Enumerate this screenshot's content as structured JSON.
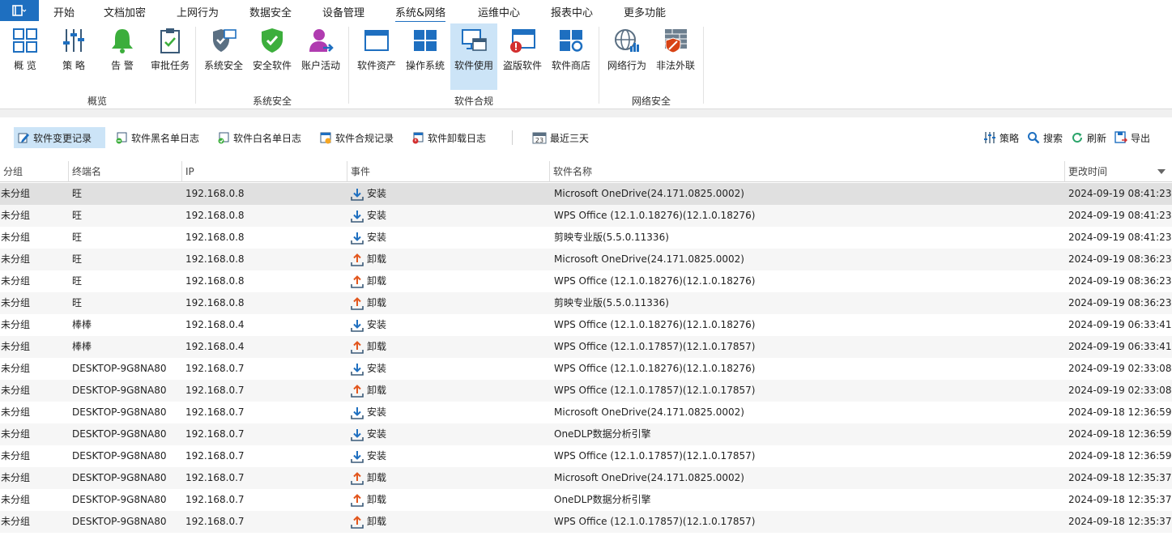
{
  "menu": {
    "items": [
      "开始",
      "文档加密",
      "上网行为",
      "数据安全",
      "设备管理",
      "系统&网络",
      "运维中心",
      "报表中心",
      "更多功能"
    ],
    "active_index": 5
  },
  "ribbon": {
    "groups": [
      {
        "label": "概览",
        "buttons": [
          {
            "label": "概 览",
            "icon": "grid-icon"
          },
          {
            "label": "策 略",
            "icon": "sliders-icon"
          },
          {
            "label": "告 警",
            "icon": "bell-icon"
          },
          {
            "label": "审批任务",
            "icon": "clipboard-check-icon"
          }
        ]
      },
      {
        "label": "系统安全",
        "buttons": [
          {
            "label": "系统安全",
            "icon": "shield-monitor-icon"
          },
          {
            "label": "安全软件",
            "icon": "shield-check-icon"
          },
          {
            "label": "账户活动",
            "icon": "user-arrow-icon"
          }
        ]
      },
      {
        "label": "软件合规",
        "buttons": [
          {
            "label": "软件资产",
            "icon": "window-icon"
          },
          {
            "label": "操作系统",
            "icon": "windows-logo-icon"
          },
          {
            "label": "软件使用",
            "icon": "monitor-window-icon"
          },
          {
            "label": "盗版软件",
            "icon": "window-warning-icon"
          },
          {
            "label": "软件商店",
            "icon": "store-icon"
          }
        ]
      },
      {
        "label": "网络安全",
        "buttons": [
          {
            "label": "网络行为",
            "icon": "globe-chart-icon"
          },
          {
            "label": "非法外联",
            "icon": "firewall-icon"
          }
        ]
      }
    ],
    "selected": "软件使用"
  },
  "toolbar": {
    "tabs": [
      "软件变更记录",
      "软件黑名单日志",
      "软件白名单日志",
      "软件合规记录",
      "软件卸载日志"
    ],
    "date_filter": "最近三天",
    "actions": [
      "策略",
      "搜索",
      "刷新",
      "导出"
    ]
  },
  "table": {
    "columns": [
      "分组",
      "终端名",
      "IP",
      "事件",
      "软件名称",
      "更改时间"
    ],
    "rows": [
      {
        "group": "未分组",
        "terminal": "旺",
        "ip": "192.168.0.8",
        "event": "安装",
        "type": "install",
        "software": "Microsoft OneDrive(24.171.0825.0002)",
        "time": "2024-09-19 08:41:23"
      },
      {
        "group": "未分组",
        "terminal": "旺",
        "ip": "192.168.0.8",
        "event": "安装",
        "type": "install",
        "software": "WPS Office (12.1.0.18276)(12.1.0.18276)",
        "time": "2024-09-19 08:41:23"
      },
      {
        "group": "未分组",
        "terminal": "旺",
        "ip": "192.168.0.8",
        "event": "安装",
        "type": "install",
        "software": "剪映专业版(5.5.0.11336)",
        "time": "2024-09-19 08:41:23"
      },
      {
        "group": "未分组",
        "terminal": "旺",
        "ip": "192.168.0.8",
        "event": "卸载",
        "type": "uninstall",
        "software": "Microsoft OneDrive(24.171.0825.0002)",
        "time": "2024-09-19 08:36:23"
      },
      {
        "group": "未分组",
        "terminal": "旺",
        "ip": "192.168.0.8",
        "event": "卸载",
        "type": "uninstall",
        "software": "WPS Office (12.1.0.18276)(12.1.0.18276)",
        "time": "2024-09-19 08:36:23"
      },
      {
        "group": "未分组",
        "terminal": "旺",
        "ip": "192.168.0.8",
        "event": "卸载",
        "type": "uninstall",
        "software": "剪映专业版(5.5.0.11336)",
        "time": "2024-09-19 08:36:23"
      },
      {
        "group": "未分组",
        "terminal": "棒棒",
        "ip": "192.168.0.4",
        "event": "安装",
        "type": "install",
        "software": "WPS Office (12.1.0.18276)(12.1.0.18276)",
        "time": "2024-09-19 06:33:41"
      },
      {
        "group": "未分组",
        "terminal": "棒棒",
        "ip": "192.168.0.4",
        "event": "卸载",
        "type": "uninstall",
        "software": "WPS Office (12.1.0.17857)(12.1.0.17857)",
        "time": "2024-09-19 06:33:41"
      },
      {
        "group": "未分组",
        "terminal": "DESKTOP-9G8NA80",
        "ip": "192.168.0.7",
        "event": "安装",
        "type": "install",
        "software": "WPS Office (12.1.0.18276)(12.1.0.18276)",
        "time": "2024-09-19 02:33:08"
      },
      {
        "group": "未分组",
        "terminal": "DESKTOP-9G8NA80",
        "ip": "192.168.0.7",
        "event": "卸载",
        "type": "uninstall",
        "software": "WPS Office (12.1.0.17857)(12.1.0.17857)",
        "time": "2024-09-19 02:33:08"
      },
      {
        "group": "未分组",
        "terminal": "DESKTOP-9G8NA80",
        "ip": "192.168.0.7",
        "event": "安装",
        "type": "install",
        "software": "Microsoft OneDrive(24.171.0825.0002)",
        "time": "2024-09-18 12:36:59"
      },
      {
        "group": "未分组",
        "terminal": "DESKTOP-9G8NA80",
        "ip": "192.168.0.7",
        "event": "安装",
        "type": "install",
        "software": "OneDLP数据分析引擎",
        "time": "2024-09-18 12:36:59"
      },
      {
        "group": "未分组",
        "terminal": "DESKTOP-9G8NA80",
        "ip": "192.168.0.7",
        "event": "安装",
        "type": "install",
        "software": "WPS Office (12.1.0.17857)(12.1.0.17857)",
        "time": "2024-09-18 12:36:59"
      },
      {
        "group": "未分组",
        "terminal": "DESKTOP-9G8NA80",
        "ip": "192.168.0.7",
        "event": "卸载",
        "type": "uninstall",
        "software": "Microsoft OneDrive(24.171.0825.0002)",
        "time": "2024-09-18 12:35:37"
      },
      {
        "group": "未分组",
        "terminal": "DESKTOP-9G8NA80",
        "ip": "192.168.0.7",
        "event": "卸载",
        "type": "uninstall",
        "software": "OneDLP数据分析引擎",
        "time": "2024-09-18 12:35:37"
      },
      {
        "group": "未分组",
        "terminal": "DESKTOP-9G8NA80",
        "ip": "192.168.0.7",
        "event": "卸载",
        "type": "uninstall",
        "software": "WPS Office (12.1.0.17857)(12.1.0.17857)",
        "time": "2024-09-18 12:35:37"
      }
    ]
  },
  "colors": {
    "accent": "#1e6fc0",
    "install": "#1e6fc0",
    "uninstall": "#e2561d",
    "selected_bg": "#cce4f7"
  }
}
